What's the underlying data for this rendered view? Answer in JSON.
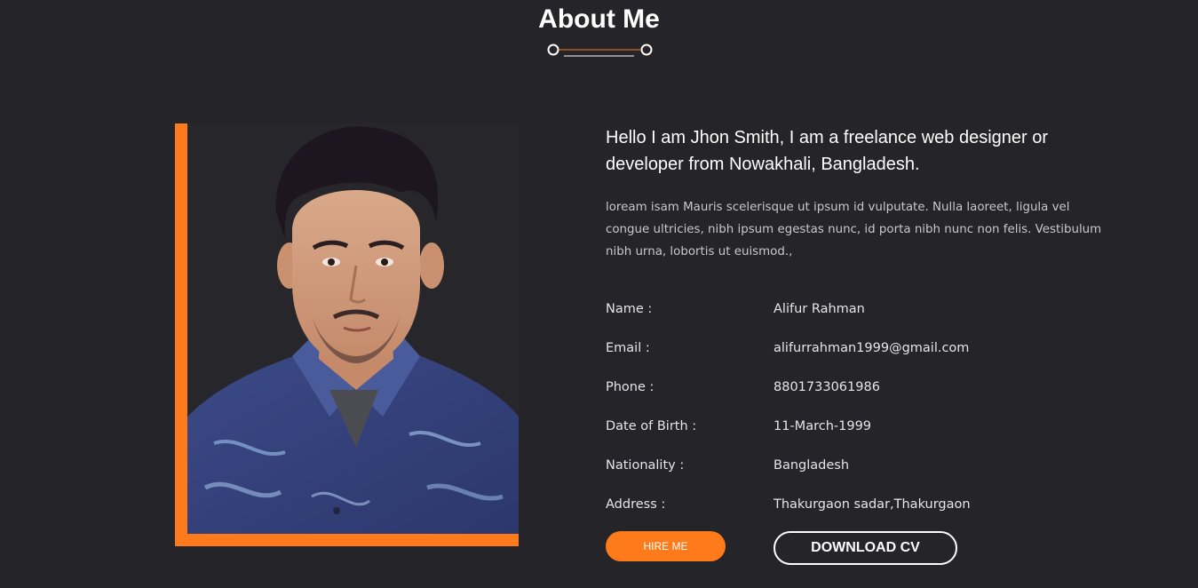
{
  "section": {
    "title": "About Me"
  },
  "intro": "Hello I am Jhon Smith, I am a freelance web designer or developer from Nowakhali, Bangladesh.",
  "bio": "loream isam Mauris scelerisque ut ipsum id vulputate. Nulla laoreet, ligula vel congue ultricies, nibh ipsum egestas nunc, id porta nibh nunc non felis. Vestibulum nibh urna, lobortis ut euismod.,",
  "info": [
    {
      "label": "Name :",
      "value": "Alifur Rahman"
    },
    {
      "label": "Email :",
      "value": "alifurrahman1999@gmail.com"
    },
    {
      "label": "Phone :",
      "value": "8801733061986"
    },
    {
      "label": "Date of Birth :",
      "value": "11-March-1999"
    },
    {
      "label": "Nationality :",
      "value": "Bangladesh"
    },
    {
      "label": "Address :",
      "value": "Thakurgaon sadar,Thakurgaon"
    }
  ],
  "buttons": {
    "hire": "HIRE ME",
    "download": "DOWNLOAD CV"
  },
  "colors": {
    "background": "#242429",
    "accent": "#ff7a1a",
    "text": "#ffffff"
  },
  "icons": {
    "divider": "line-with-circle-ends"
  }
}
